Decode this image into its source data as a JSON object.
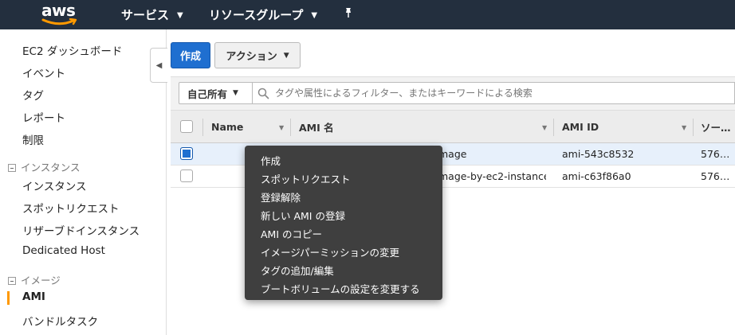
{
  "topbar": {
    "logo_text": "aws",
    "services_label": "サービス",
    "resource_groups_label": "リソースグループ",
    "pin_icon": "pin-icon"
  },
  "sidebar": {
    "items": [
      {
        "label": "EC2 ダッシュボード"
      },
      {
        "label": "イベント"
      },
      {
        "label": "タグ"
      },
      {
        "label": "レポート"
      },
      {
        "label": "制限"
      }
    ],
    "instances_section": "インスタンス",
    "instances_items": [
      {
        "label": "インスタンス"
      },
      {
        "label": "スポットリクエスト"
      },
      {
        "label": "リザーブドインスタンス"
      },
      {
        "label": "Dedicated Host"
      }
    ],
    "images_section": "イメージ",
    "images_items": [
      {
        "label": "AMI",
        "active": true
      },
      {
        "label": "バンドルタスク"
      }
    ]
  },
  "toolbar": {
    "create_label": "作成",
    "actions_label": "アクション"
  },
  "filter": {
    "owner_label": "自己所有",
    "search_placeholder": "タグや属性によるフィルター、またはキーワードによる検索"
  },
  "table": {
    "columns": [
      "Name",
      "AMI 名",
      "AMI ID",
      "ソー…"
    ],
    "rows": [
      {
        "name": "",
        "ami_name": "mage",
        "ami_id": "ami-543c8532",
        "source": "576…",
        "selected": true
      },
      {
        "name": "",
        "ami_name": "mage-by-ec2-instance",
        "ami_id": "ami-c63f86a0",
        "source": "576…",
        "selected": false
      }
    ]
  },
  "context_menu": {
    "items": [
      "作成",
      "スポットリクエスト",
      "登録解除",
      "新しい AMI の登録",
      "AMI のコピー",
      "イメージパーミッションの変更",
      "タグの追加/編集",
      "ブートボリュームの設定を変更する"
    ]
  },
  "colors": {
    "nav_bg": "#232f3e",
    "primary_button": "#1f6fd0",
    "accent_orange": "#ff9900",
    "menu_bg": "#3f3f3f"
  }
}
